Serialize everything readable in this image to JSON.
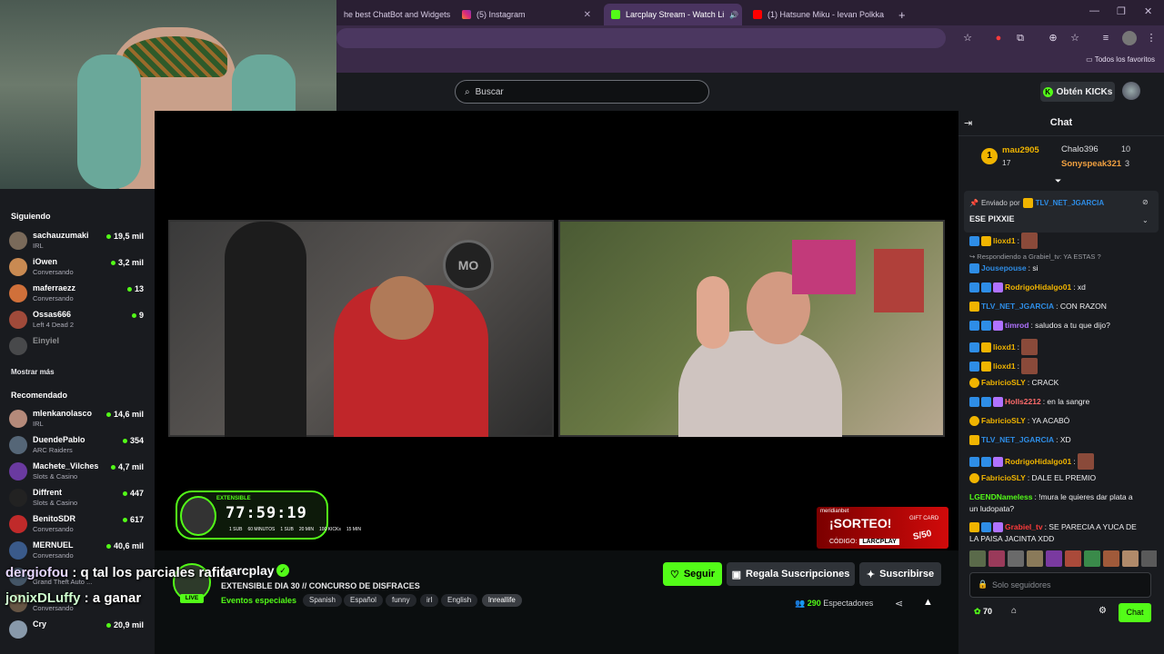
{
  "browser": {
    "tabs": [
      {
        "label": "he best ChatBot and Widgets",
        "active": false
      },
      {
        "label": "(5) Instagram",
        "active": false
      },
      {
        "label": "Larcplay Stream - Watch Li",
        "active": true
      },
      {
        "label": "(1) Hatsune Miku - Ievan Polkka",
        "active": false
      }
    ],
    "bookmarks_label": "Todos los favoritos"
  },
  "topnav": {
    "search_placeholder": "Buscar",
    "kicks_button": "Obtén KICKs"
  },
  "sidebar": {
    "following_title": "Siguiendo",
    "following": [
      {
        "name": "sachauzumaki",
        "category": "IRL",
        "viewers": "19,5 mil",
        "color": "#7a6a5a"
      },
      {
        "name": "iOwen",
        "category": "Conversando",
        "viewers": "3,2 mil",
        "color": "#c98a52"
      },
      {
        "name": "maferraezz",
        "category": "Conversando",
        "viewers": "13",
        "color": "#d0703a"
      },
      {
        "name": "Ossas666",
        "category": "Left 4 Dead 2",
        "viewers": "9",
        "color": "#a04a3a"
      },
      {
        "name": "Einyiel",
        "category": "",
        "viewers": "",
        "color": "#777777"
      }
    ],
    "show_more": "Mostrar más",
    "recommended_title": "Recomendado",
    "recommended": [
      {
        "name": "mlenkanolasco",
        "category": "IRL",
        "viewers": "14,6 mil",
        "color": "#b58a7a"
      },
      {
        "name": "DuendePablo",
        "category": "ARC Raiders",
        "viewers": "354",
        "color": "#556677"
      },
      {
        "name": "Machete_Vilches",
        "category": "Slots & Casino",
        "viewers": "4,7 mil",
        "color": "#6a3aa0"
      },
      {
        "name": "Diffrent",
        "category": "Slots & Casino",
        "viewers": "447",
        "color": "#222222"
      },
      {
        "name": "BenitoSDR",
        "category": "Conversando",
        "viewers": "617",
        "color": "#c02a2a"
      },
      {
        "name": "MERNUEL",
        "category": "Conversando",
        "viewers": "40,6 mil",
        "color": "#3a5a8a"
      },
      {
        "name": "",
        "category": "Grand Theft Auto ...",
        "viewers": "",
        "color": "#445566"
      },
      {
        "name": "",
        "category": "Conversando",
        "viewers": "",
        "color": "#665544"
      },
      {
        "name": "Cry",
        "category": "",
        "viewers": "20,9 mil",
        "color": "#8899aa"
      }
    ]
  },
  "overlay_chat": [
    {
      "user": "dergiofou",
      "text": " : q tal los parciales rafita"
    },
    {
      "user": "jonixDLuffy",
      "text": " : a ganar"
    }
  ],
  "video": {
    "timer_label": "EXTENSIBLE",
    "timer": "77:59:19",
    "timer_subs": [
      "1 SUB",
      "60 MINUTOS",
      "1 SUB",
      "20 MIN",
      "100 KICKs",
      "15 MIN"
    ],
    "sponsor_brand": "meridianbet",
    "sponsor_title": "¡SORTEO!",
    "sponsor_code_label": "CÓDIGO:",
    "sponsor_code": "LARCPLAY",
    "sponsor_card": "GIFT CARD",
    "sponsor_amount": "S/50"
  },
  "stream": {
    "channel": "Larcplay",
    "live_badge": "LIVE",
    "title": "EXTENSIBLE DIA 30 // CONCURSO DE DISFRACES",
    "category": "Eventos especiales",
    "tags": [
      "Spanish",
      "Español",
      "funny",
      "irl",
      "English",
      "lnreallife"
    ],
    "follow": "Seguir",
    "gift": "Regala Suscripciones",
    "subscribe": "Suscribirse",
    "viewers": "290",
    "viewers_label": "Espectadores"
  },
  "chat": {
    "title": "Chat",
    "leaderboard": [
      {
        "rank": "1",
        "name": "mau2905",
        "value": "17"
      },
      {
        "name": "Chalo396",
        "value": "10"
      },
      {
        "name": "Sonyspeak321",
        "value": "3"
      }
    ],
    "pinned_by_label": "Enviado por",
    "pinned_by": "TLV_NET_JGARCIA",
    "pinned_text": "ESE PIXXIE",
    "messages": [
      {
        "user": "lioxd1",
        "text": ":",
        "color": "#f0b400",
        "badges": [
          "blue",
          "gold"
        ],
        "emote": true
      },
      {
        "reply": "Respondiendo a Grabiel_tv: YA ESTAS ?"
      },
      {
        "user": "Jousepouse",
        "text": ": si",
        "color": "#2e8de6",
        "badges": [
          "blue"
        ]
      },
      {
        "user": "RodrigoHidalgo01",
        "text": ": xd",
        "color": "#f0b400",
        "badges": [
          "blue",
          "blue",
          "purple"
        ]
      },
      {
        "user": "TLV_NET_JGARCIA",
        "text": ": CON RAZON",
        "color": "#2e8de6",
        "badges": [
          "gold"
        ]
      },
      {
        "user": "timrod",
        "text": ": saludos a tu que dijo?",
        "color": "#b072ff",
        "badges": [
          "blue",
          "blue",
          "purple"
        ]
      },
      {
        "user": "lioxd1",
        "text": ":",
        "color": "#f0b400",
        "badges": [
          "blue",
          "gold"
        ],
        "emote": true
      },
      {
        "user": "lioxd1",
        "text": ":",
        "color": "#f0b400",
        "badges": [
          "blue",
          "gold"
        ],
        "emote": true
      },
      {
        "user": "FabricioSLY",
        "text": ": CRACK",
        "color": "#f0b400",
        "badges": [
          "coin"
        ]
      },
      {
        "user": "Holls2212",
        "text": ": en la sangre",
        "color": "#ff6b6b",
        "badges": [
          "blue",
          "blue",
          "purple"
        ]
      },
      {
        "user": "FabricioSLY",
        "text": ": YA ACABÓ",
        "color": "#f0b400",
        "badges": [
          "coin"
        ]
      },
      {
        "user": "TLV_NET_JGARCIA",
        "text": ": XD",
        "color": "#2e8de6",
        "badges": [
          "gold"
        ]
      },
      {
        "user": "RodrigoHidalgo01",
        "text": ":",
        "color": "#f0b400",
        "badges": [
          "blue",
          "blue",
          "purple"
        ],
        "emote": true
      },
      {
        "user": "FabricioSLY",
        "text": ": DALE EL PREMIO",
        "color": "#f0b400",
        "badges": [
          "coin"
        ]
      },
      {
        "user": "LGENDNameless",
        "text": ": !mura le quieres dar plata a",
        "color": "#53fc18",
        "badges": []
      },
      {
        "cont": "un ludopata?"
      },
      {
        "user": "Grabiel_tv",
        "text": ": SE PARECIA A YUCA DE",
        "color": "#ff3b3b",
        "badges": [
          "gold",
          "blue",
          "purple"
        ]
      },
      {
        "cont": "LA PAISA JACINTA XDD"
      }
    ],
    "input_placeholder": "Solo seguidores",
    "points": "70",
    "send": "Chat"
  },
  "colors": {
    "accent": "#53fc18",
    "panel": "#191b1f",
    "bg": "#0b0e0f"
  }
}
